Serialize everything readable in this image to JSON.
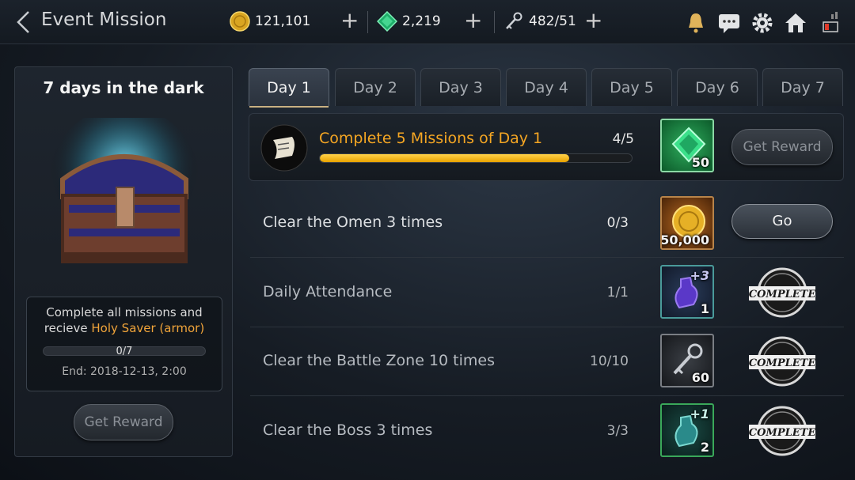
{
  "header": {
    "title": "Event Mission",
    "gold": "121,101",
    "gems": "2,219",
    "keys": "482/51"
  },
  "event": {
    "title": "7 days in the dark",
    "desc_line1": "Complete all missions and",
    "desc_prefix": "recieve ",
    "desc_highlight": "Holy Saver (armor)",
    "progress": "0/7",
    "end": "End: 2018-12-13, 2:00",
    "reward_button": "Get Reward"
  },
  "tabs": [
    {
      "label": "Day 1",
      "active": true
    },
    {
      "label": "Day 2"
    },
    {
      "label": "Day 3"
    },
    {
      "label": "Day 4"
    },
    {
      "label": "Day 5"
    },
    {
      "label": "Day 6"
    },
    {
      "label": "Day 7"
    }
  ],
  "summary": {
    "title": "Complete 5 Missions of Day 1",
    "count": "4/5",
    "progress_fraction": 0.8,
    "reward_qty": "50",
    "reward_icon": "gem-icon",
    "button": "Get Reward"
  },
  "missions": [
    {
      "name": "Clear the Omen 3 times",
      "count": "0/3",
      "reward_qty": "50,000",
      "reward_icon": "gold-coin-icon",
      "status": "Go"
    },
    {
      "name": "Daily Attendance",
      "count": "1/1",
      "reward_qty": "1",
      "reward_badge": "+3",
      "reward_icon": "purple-potion-icon",
      "status": "COMPLETE"
    },
    {
      "name": "Clear the Battle Zone 10 times",
      "count": "10/10",
      "reward_qty": "60",
      "reward_icon": "key-icon",
      "status": "COMPLETE"
    },
    {
      "name": "Clear the Boss 3 times",
      "count": "3/3",
      "reward_qty": "2",
      "reward_badge": "+1",
      "reward_icon": "teal-potion-icon",
      "status": "COMPLETE"
    }
  ],
  "colors": {
    "accent_orange": "#f5a623",
    "progress_yellow": "#f2c12e"
  }
}
